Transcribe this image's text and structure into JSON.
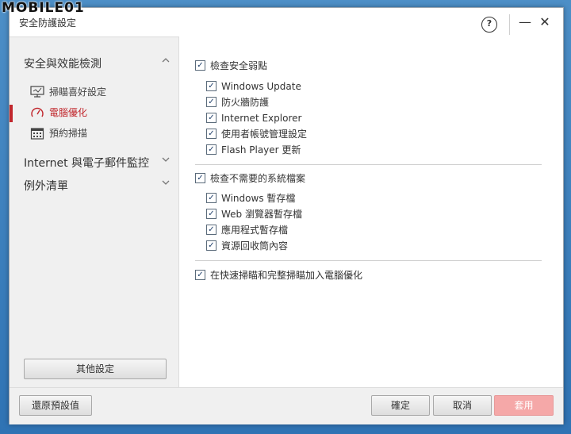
{
  "watermark": "MOBILE01",
  "window": {
    "title": "安全防護設定",
    "help_glyph": "?",
    "minimize_glyph": "—",
    "close_glyph": "✕"
  },
  "sidebar": {
    "sections": [
      {
        "label": "安全與效能檢測",
        "expanded": true
      },
      {
        "label": "Internet 與電子郵件監控",
        "expanded": false
      },
      {
        "label": "例外清單",
        "expanded": false
      }
    ],
    "sub_items": [
      {
        "label": "掃瞄喜好設定",
        "icon": "monitor-icon",
        "active": false
      },
      {
        "label": "電腦優化",
        "icon": "speedometer-icon",
        "active": true
      },
      {
        "label": "預約掃描",
        "icon": "calendar-icon",
        "active": false
      }
    ],
    "other_settings_label": "其他設定"
  },
  "content": {
    "group1": {
      "label": "檢查安全弱點",
      "checked": true,
      "items": [
        {
          "label": "Windows Update",
          "checked": true
        },
        {
          "label": "防火牆防護",
          "checked": true
        },
        {
          "label": "Internet Explorer",
          "checked": true
        },
        {
          "label": "使用者帳號管理設定",
          "checked": true
        },
        {
          "label": "Flash Player 更新",
          "checked": true
        }
      ]
    },
    "group2": {
      "label": "檢查不需要的系統檔案",
      "checked": true,
      "items": [
        {
          "label": "Windows 暫存檔",
          "checked": true
        },
        {
          "label": "Web 瀏覽器暫存檔",
          "checked": true
        },
        {
          "label": "應用程式暫存檔",
          "checked": true
        },
        {
          "label": "資源回收筒內容",
          "checked": true
        }
      ]
    },
    "option3": {
      "label": "在快速掃瞄和完整掃瞄加入電腦優化",
      "checked": true
    }
  },
  "footer": {
    "restore_label": "還原預設值",
    "ok_label": "確定",
    "cancel_label": "取消",
    "apply_label": "套用"
  },
  "colors": {
    "accent": "#c1272d",
    "apply_disabled": "#f5a8a8"
  }
}
